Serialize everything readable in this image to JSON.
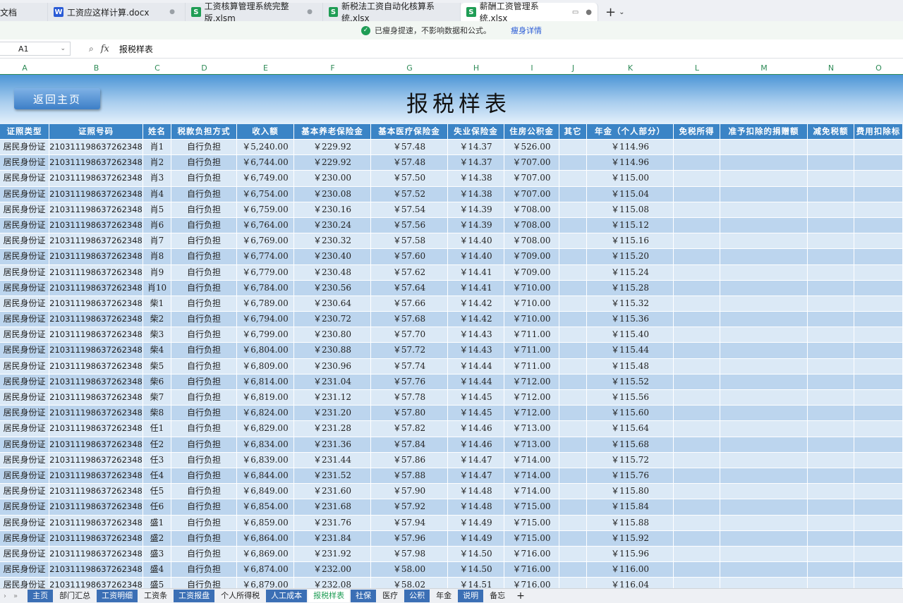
{
  "tabs": [
    {
      "icon": "",
      "label": "文档",
      "close": ""
    },
    {
      "icon": "W",
      "type": "w",
      "label": "工资应这样计算.docx",
      "close": "●"
    },
    {
      "icon": "S",
      "type": "s",
      "label": "工资核算管理系统完整版.xlsm",
      "close": "●"
    },
    {
      "icon": "S",
      "type": "s",
      "label": "新税法工资自动化核算系统.xlsx",
      "close": ""
    },
    {
      "icon": "S",
      "type": "s",
      "label": "薪酬工资管理系统.xlsx",
      "close": "●",
      "active": true
    }
  ],
  "tab_add": "+",
  "notice": {
    "text": "已瘦身提速，不影响数据和公式。",
    "link": "瘦身详情"
  },
  "formula": {
    "namebox": "A1",
    "fx": "fx",
    "value": "报税样表"
  },
  "columns": [
    "A",
    "B",
    "C",
    "D",
    "E",
    "F",
    "G",
    "H",
    "I",
    "J",
    "K",
    "L",
    "M",
    "N",
    "O"
  ],
  "banner": {
    "back_button": "返回主页",
    "title": "报税样表"
  },
  "headers": [
    "证照类型",
    "证照号码",
    "姓名",
    "税款负担方式",
    "收入额",
    "基本养老保险金",
    "基本医疗保险金",
    "失业保险金",
    "住房公积金",
    "其它",
    "年金（个人部分）",
    "免税所得",
    "准予扣除的捐赠额",
    "减免税额",
    "费用扣除标"
  ],
  "id_type": "居民身份证",
  "id_no": "210311198637262348",
  "burden": "自行负担",
  "rows": [
    [
      "肖1",
      "￥5,240.00",
      "￥229.92",
      "￥57.48",
      "￥14.37",
      "￥526.00",
      "￥114.96"
    ],
    [
      "肖2",
      "￥6,744.00",
      "￥229.92",
      "￥57.48",
      "￥14.37",
      "￥707.00",
      "￥114.96"
    ],
    [
      "肖3",
      "￥6,749.00",
      "￥230.00",
      "￥57.50",
      "￥14.38",
      "￥707.00",
      "￥115.00"
    ],
    [
      "肖4",
      "￥6,754.00",
      "￥230.08",
      "￥57.52",
      "￥14.38",
      "￥707.00",
      "￥115.04"
    ],
    [
      "肖5",
      "￥6,759.00",
      "￥230.16",
      "￥57.54",
      "￥14.39",
      "￥708.00",
      "￥115.08"
    ],
    [
      "肖6",
      "￥6,764.00",
      "￥230.24",
      "￥57.56",
      "￥14.39",
      "￥708.00",
      "￥115.12"
    ],
    [
      "肖7",
      "￥6,769.00",
      "￥230.32",
      "￥57.58",
      "￥14.40",
      "￥708.00",
      "￥115.16"
    ],
    [
      "肖8",
      "￥6,774.00",
      "￥230.40",
      "￥57.60",
      "￥14.40",
      "￥709.00",
      "￥115.20"
    ],
    [
      "肖9",
      "￥6,779.00",
      "￥230.48",
      "￥57.62",
      "￥14.41",
      "￥709.00",
      "￥115.24"
    ],
    [
      "肖10",
      "￥6,784.00",
      "￥230.56",
      "￥57.64",
      "￥14.41",
      "￥710.00",
      "￥115.28"
    ],
    [
      "柴1",
      "￥6,789.00",
      "￥230.64",
      "￥57.66",
      "￥14.42",
      "￥710.00",
      "￥115.32"
    ],
    [
      "柴2",
      "￥6,794.00",
      "￥230.72",
      "￥57.68",
      "￥14.42",
      "￥710.00",
      "￥115.36"
    ],
    [
      "柴3",
      "￥6,799.00",
      "￥230.80",
      "￥57.70",
      "￥14.43",
      "￥711.00",
      "￥115.40"
    ],
    [
      "柴4",
      "￥6,804.00",
      "￥230.88",
      "￥57.72",
      "￥14.43",
      "￥711.00",
      "￥115.44"
    ],
    [
      "柴5",
      "￥6,809.00",
      "￥230.96",
      "￥57.74",
      "￥14.44",
      "￥711.00",
      "￥115.48"
    ],
    [
      "柴6",
      "￥6,814.00",
      "￥231.04",
      "￥57.76",
      "￥14.44",
      "￥712.00",
      "￥115.52"
    ],
    [
      "柴7",
      "￥6,819.00",
      "￥231.12",
      "￥57.78",
      "￥14.45",
      "￥712.00",
      "￥115.56"
    ],
    [
      "柴8",
      "￥6,824.00",
      "￥231.20",
      "￥57.80",
      "￥14.45",
      "￥712.00",
      "￥115.60"
    ],
    [
      "任1",
      "￥6,829.00",
      "￥231.28",
      "￥57.82",
      "￥14.46",
      "￥713.00",
      "￥115.64"
    ],
    [
      "任2",
      "￥6,834.00",
      "￥231.36",
      "￥57.84",
      "￥14.46",
      "￥713.00",
      "￥115.68"
    ],
    [
      "任3",
      "￥6,839.00",
      "￥231.44",
      "￥57.86",
      "￥14.47",
      "￥714.00",
      "￥115.72"
    ],
    [
      "任4",
      "￥6,844.00",
      "￥231.52",
      "￥57.88",
      "￥14.47",
      "￥714.00",
      "￥115.76"
    ],
    [
      "任5",
      "￥6,849.00",
      "￥231.60",
      "￥57.90",
      "￥14.48",
      "￥714.00",
      "￥115.80"
    ],
    [
      "任6",
      "￥6,854.00",
      "￥231.68",
      "￥57.92",
      "￥14.48",
      "￥715.00",
      "￥115.84"
    ],
    [
      "盛1",
      "￥6,859.00",
      "￥231.76",
      "￥57.94",
      "￥14.49",
      "￥715.00",
      "￥115.88"
    ],
    [
      "盛2",
      "￥6,864.00",
      "￥231.84",
      "￥57.96",
      "￥14.49",
      "￥715.00",
      "￥115.92"
    ],
    [
      "盛3",
      "￥6,869.00",
      "￥231.92",
      "￥57.98",
      "￥14.50",
      "￥716.00",
      "￥115.96"
    ],
    [
      "盛4",
      "￥6,874.00",
      "￥232.00",
      "￥58.00",
      "￥14.50",
      "￥716.00",
      "￥116.00"
    ],
    [
      "盛5",
      "￥6,879.00",
      "￥232.08",
      "￥58.02",
      "￥14.51",
      "￥716.00",
      "￥116.04"
    ]
  ],
  "sheets": [
    {
      "label": "主页",
      "style": "blue"
    },
    {
      "label": "部门汇总",
      "style": ""
    },
    {
      "label": "工资明细",
      "style": "blue"
    },
    {
      "label": "工资条",
      "style": ""
    },
    {
      "label": "工资报盘",
      "style": "blue"
    },
    {
      "label": "个人所得税",
      "style": ""
    },
    {
      "label": "人工成本",
      "style": "blue"
    },
    {
      "label": "报税样表",
      "style": "active"
    },
    {
      "label": "社保",
      "style": "blue"
    },
    {
      "label": "医疗",
      "style": ""
    },
    {
      "label": "公积",
      "style": "blue"
    },
    {
      "label": "年金",
      "style": ""
    },
    {
      "label": "说明",
      "style": "blue"
    },
    {
      "label": "备忘",
      "style": ""
    }
  ],
  "sheet_add": "+",
  "colors": {
    "header_blue": "#3b84c6",
    "row_light": "#dbe9f6",
    "row_dark": "#bcd5ee",
    "accent_green": "#1f9d55"
  }
}
